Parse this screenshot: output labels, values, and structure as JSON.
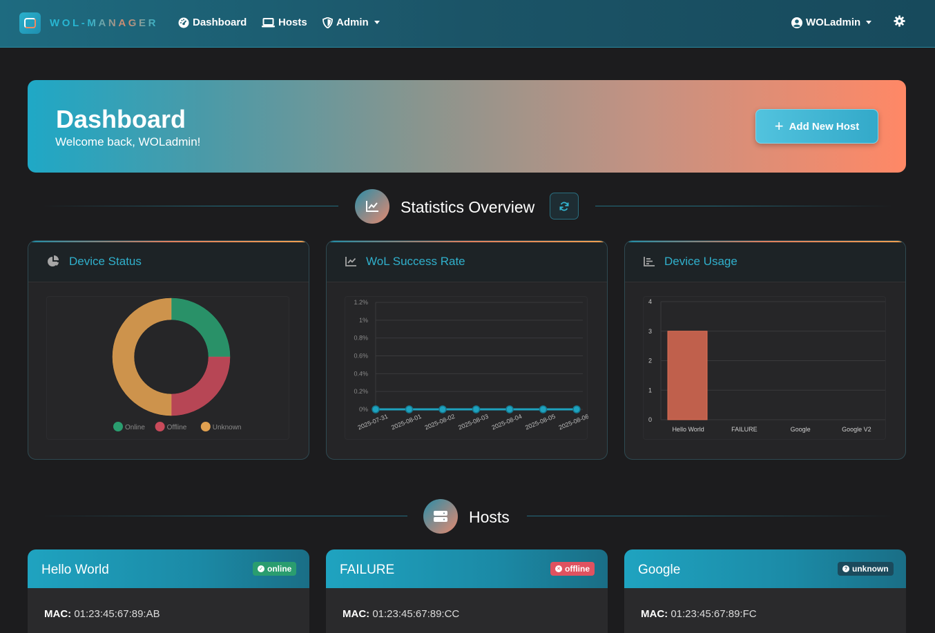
{
  "navbar": {
    "brand": "WOL-MANAGER",
    "items": [
      {
        "label": "Dashboard",
        "icon": "gauge-icon"
      },
      {
        "label": "Hosts",
        "icon": "laptop-icon"
      },
      {
        "label": "Admin",
        "icon": "shield-icon"
      }
    ],
    "user": "WOLadmin",
    "settings_icon": "gear-icon"
  },
  "hero": {
    "title": "Dashboard",
    "subtitle": "Welcome back, WOLadmin!",
    "add_button": "Add New Host"
  },
  "stats_section": {
    "title": "Statistics Overview"
  },
  "cards": {
    "status": {
      "title": "Device Status"
    },
    "success": {
      "title": "WoL Success Rate"
    },
    "usage": {
      "title": "Device Usage"
    }
  },
  "hosts_section": {
    "title": "Hosts"
  },
  "hosts": [
    {
      "name": "Hello World",
      "status": "online",
      "mac_label": "MAC:",
      "mac": "01:23:45:67:89:AB"
    },
    {
      "name": "FAILURE",
      "status": "offline",
      "mac_label": "MAC:",
      "mac": "01:23:45:67:89:CC"
    },
    {
      "name": "Google",
      "status": "unknown",
      "mac_label": "MAC:",
      "mac": "01:23:45:67:89:FC"
    }
  ],
  "colors": {
    "accent": "#30b0cc",
    "online": "#2a9d6f",
    "offline": "#e05260",
    "unknown": "#e8a050",
    "bar": "#c0604c"
  },
  "chart_data": [
    {
      "type": "pie",
      "categories": [
        "Online",
        "Offline",
        "Unknown"
      ],
      "values": [
        1,
        1,
        2
      ],
      "colors": [
        "#2a9d6f",
        "#c84a5a",
        "#e0a050"
      ],
      "legend": "bottom"
    },
    {
      "type": "line",
      "x": [
        "2025-07-31",
        "2025-08-01",
        "2025-08-02",
        "2025-08-03",
        "2025-08-04",
        "2025-08-05",
        "2025-08-06"
      ],
      "values": [
        0,
        0,
        0,
        0,
        0,
        0,
        0
      ],
      "yticks": [
        "0%",
        "0.2%",
        "0.4%",
        "0.6%",
        "0.8%",
        "1%",
        "1.2%"
      ],
      "ylim": [
        0,
        1.2
      ]
    },
    {
      "type": "bar",
      "categories": [
        "Hello World",
        "FAILURE",
        "Google",
        "Google V2"
      ],
      "values": [
        3,
        0,
        0,
        0
      ],
      "yticks": [
        "0",
        "1",
        "2",
        "3",
        "4"
      ],
      "ylim": [
        0,
        4
      ]
    }
  ]
}
